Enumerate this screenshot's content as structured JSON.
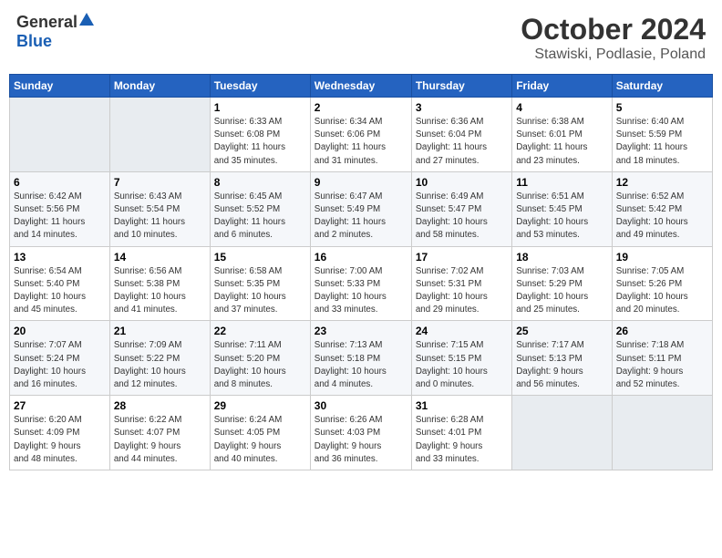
{
  "header": {
    "logo_general": "General",
    "logo_blue": "Blue",
    "month_title": "October 2024",
    "location": "Stawiski, Podlasie, Poland"
  },
  "days_of_week": [
    "Sunday",
    "Monday",
    "Tuesday",
    "Wednesday",
    "Thursday",
    "Friday",
    "Saturday"
  ],
  "weeks": [
    [
      {
        "day": "",
        "info": ""
      },
      {
        "day": "",
        "info": ""
      },
      {
        "day": "1",
        "info": "Sunrise: 6:33 AM\nSunset: 6:08 PM\nDaylight: 11 hours\nand 35 minutes."
      },
      {
        "day": "2",
        "info": "Sunrise: 6:34 AM\nSunset: 6:06 PM\nDaylight: 11 hours\nand 31 minutes."
      },
      {
        "day": "3",
        "info": "Sunrise: 6:36 AM\nSunset: 6:04 PM\nDaylight: 11 hours\nand 27 minutes."
      },
      {
        "day": "4",
        "info": "Sunrise: 6:38 AM\nSunset: 6:01 PM\nDaylight: 11 hours\nand 23 minutes."
      },
      {
        "day": "5",
        "info": "Sunrise: 6:40 AM\nSunset: 5:59 PM\nDaylight: 11 hours\nand 18 minutes."
      }
    ],
    [
      {
        "day": "6",
        "info": "Sunrise: 6:42 AM\nSunset: 5:56 PM\nDaylight: 11 hours\nand 14 minutes."
      },
      {
        "day": "7",
        "info": "Sunrise: 6:43 AM\nSunset: 5:54 PM\nDaylight: 11 hours\nand 10 minutes."
      },
      {
        "day": "8",
        "info": "Sunrise: 6:45 AM\nSunset: 5:52 PM\nDaylight: 11 hours\nand 6 minutes."
      },
      {
        "day": "9",
        "info": "Sunrise: 6:47 AM\nSunset: 5:49 PM\nDaylight: 11 hours\nand 2 minutes."
      },
      {
        "day": "10",
        "info": "Sunrise: 6:49 AM\nSunset: 5:47 PM\nDaylight: 10 hours\nand 58 minutes."
      },
      {
        "day": "11",
        "info": "Sunrise: 6:51 AM\nSunset: 5:45 PM\nDaylight: 10 hours\nand 53 minutes."
      },
      {
        "day": "12",
        "info": "Sunrise: 6:52 AM\nSunset: 5:42 PM\nDaylight: 10 hours\nand 49 minutes."
      }
    ],
    [
      {
        "day": "13",
        "info": "Sunrise: 6:54 AM\nSunset: 5:40 PM\nDaylight: 10 hours\nand 45 minutes."
      },
      {
        "day": "14",
        "info": "Sunrise: 6:56 AM\nSunset: 5:38 PM\nDaylight: 10 hours\nand 41 minutes."
      },
      {
        "day": "15",
        "info": "Sunrise: 6:58 AM\nSunset: 5:35 PM\nDaylight: 10 hours\nand 37 minutes."
      },
      {
        "day": "16",
        "info": "Sunrise: 7:00 AM\nSunset: 5:33 PM\nDaylight: 10 hours\nand 33 minutes."
      },
      {
        "day": "17",
        "info": "Sunrise: 7:02 AM\nSunset: 5:31 PM\nDaylight: 10 hours\nand 29 minutes."
      },
      {
        "day": "18",
        "info": "Sunrise: 7:03 AM\nSunset: 5:29 PM\nDaylight: 10 hours\nand 25 minutes."
      },
      {
        "day": "19",
        "info": "Sunrise: 7:05 AM\nSunset: 5:26 PM\nDaylight: 10 hours\nand 20 minutes."
      }
    ],
    [
      {
        "day": "20",
        "info": "Sunrise: 7:07 AM\nSunset: 5:24 PM\nDaylight: 10 hours\nand 16 minutes."
      },
      {
        "day": "21",
        "info": "Sunrise: 7:09 AM\nSunset: 5:22 PM\nDaylight: 10 hours\nand 12 minutes."
      },
      {
        "day": "22",
        "info": "Sunrise: 7:11 AM\nSunset: 5:20 PM\nDaylight: 10 hours\nand 8 minutes."
      },
      {
        "day": "23",
        "info": "Sunrise: 7:13 AM\nSunset: 5:18 PM\nDaylight: 10 hours\nand 4 minutes."
      },
      {
        "day": "24",
        "info": "Sunrise: 7:15 AM\nSunset: 5:15 PM\nDaylight: 10 hours\nand 0 minutes."
      },
      {
        "day": "25",
        "info": "Sunrise: 7:17 AM\nSunset: 5:13 PM\nDaylight: 9 hours\nand 56 minutes."
      },
      {
        "day": "26",
        "info": "Sunrise: 7:18 AM\nSunset: 5:11 PM\nDaylight: 9 hours\nand 52 minutes."
      }
    ],
    [
      {
        "day": "27",
        "info": "Sunrise: 6:20 AM\nSunset: 4:09 PM\nDaylight: 9 hours\nand 48 minutes."
      },
      {
        "day": "28",
        "info": "Sunrise: 6:22 AM\nSunset: 4:07 PM\nDaylight: 9 hours\nand 44 minutes."
      },
      {
        "day": "29",
        "info": "Sunrise: 6:24 AM\nSunset: 4:05 PM\nDaylight: 9 hours\nand 40 minutes."
      },
      {
        "day": "30",
        "info": "Sunrise: 6:26 AM\nSunset: 4:03 PM\nDaylight: 9 hours\nand 36 minutes."
      },
      {
        "day": "31",
        "info": "Sunrise: 6:28 AM\nSunset: 4:01 PM\nDaylight: 9 hours\nand 33 minutes."
      },
      {
        "day": "",
        "info": ""
      },
      {
        "day": "",
        "info": ""
      }
    ]
  ]
}
